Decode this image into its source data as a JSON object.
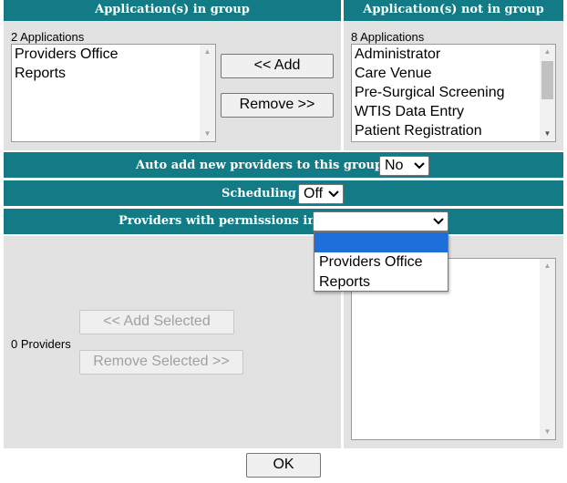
{
  "headers": {
    "in_group": "Application(s) in group",
    "not_in_group": "Application(s) not in group"
  },
  "in_group": {
    "count_label": "2 Applications",
    "items": [
      "Providers Office",
      "Reports"
    ]
  },
  "not_in_group": {
    "count_label": "8 Applications",
    "items": [
      "Administrator",
      "Care Venue",
      "Pre-Surgical Screening",
      "WTIS Data Entry",
      "Patient Registration"
    ]
  },
  "buttons": {
    "add": "<< Add",
    "remove": "Remove >>",
    "add_selected": "<< Add Selected",
    "remove_selected": "Remove Selected >>",
    "ok": "OK"
  },
  "auto_add": {
    "label": "Auto add new providers to this group",
    "value": "No"
  },
  "scheduling": {
    "label": "Scheduling",
    "value": "Off"
  },
  "permissions": {
    "label": "Providers with permissions in",
    "value": "",
    "options": [
      "",
      "Providers Office",
      "Reports"
    ]
  },
  "providers": {
    "count_label": "0 Providers"
  },
  "icons": {
    "scroll_up": "▲",
    "scroll_down": "▼",
    "chevron": "⌵"
  },
  "colors": {
    "header_teal": "#127b85",
    "panel_gray": "#e2e2e2",
    "highlight_blue": "#1e6fd9"
  }
}
